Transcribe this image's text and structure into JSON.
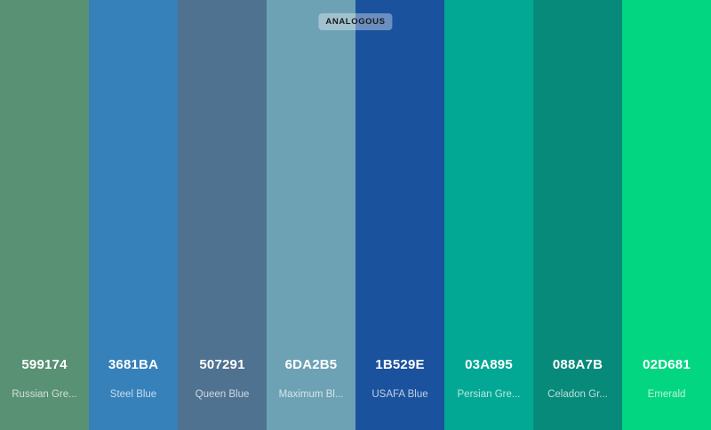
{
  "badge": "ANALOGOUS",
  "swatches": [
    {
      "hex": "599174",
      "name": "Russian Gre...",
      "color": "#599174"
    },
    {
      "hex": "3681BA",
      "name": "Steel Blue",
      "color": "#3681BA"
    },
    {
      "hex": "507291",
      "name": "Queen Blue",
      "color": "#507291"
    },
    {
      "hex": "6DA2B5",
      "name": "Maximum Bl...",
      "color": "#6DA2B5"
    },
    {
      "hex": "1B529E",
      "name": "USAFA Blue",
      "color": "#1B529E"
    },
    {
      "hex": "03A895",
      "name": "Persian Gre...",
      "color": "#03A895"
    },
    {
      "hex": "088A7B",
      "name": "Celadon Gr...",
      "color": "#088A7B"
    },
    {
      "hex": "02D681",
      "name": "Emerald",
      "color": "#02D681"
    }
  ]
}
